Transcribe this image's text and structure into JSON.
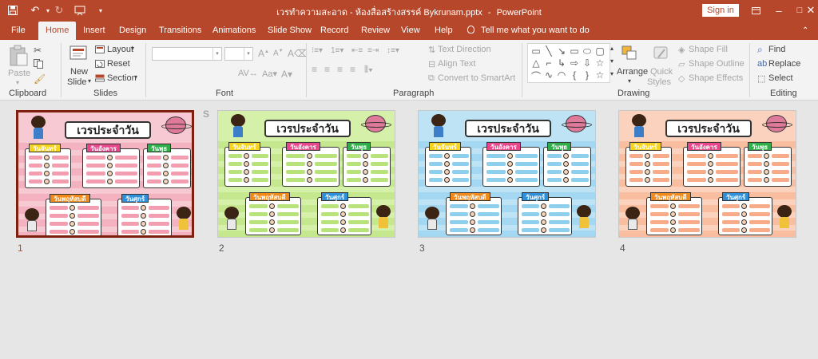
{
  "window": {
    "title": "เวรทำความสะอาด - ห้องสื่อสร้างสรรค์ Bykrunam.pptx",
    "app": "PowerPoint",
    "separator": "-",
    "signin_label": "Sign in"
  },
  "tabs": [
    "File",
    "Home",
    "Insert",
    "Design",
    "Transitions",
    "Animations",
    "Slide Show",
    "Record",
    "Review",
    "View",
    "Help"
  ],
  "active_tab": "Home",
  "tell_me": "Tell me what you want to do",
  "ribbon": {
    "clipboard": {
      "label": "Clipboard",
      "paste": "Paste"
    },
    "slides": {
      "label": "Slides",
      "new_slide": "New",
      "new_slide2": "Slide",
      "layout": "Layout",
      "reset": "Reset",
      "section": "Section"
    },
    "font": {
      "label": "Font",
      "bold": "B",
      "italic": "I",
      "underline": "U",
      "shadow": "S",
      "strike": "abc"
    },
    "paragraph": {
      "label": "Paragraph",
      "text_direction": "Text Direction",
      "align_text": "Align Text",
      "smartart": "Convert to SmartArt"
    },
    "drawing": {
      "label": "Drawing",
      "arrange": "Arrange",
      "quick_styles": "Quick",
      "quick_styles2": "Styles",
      "shape_fill": "Shape Fill",
      "shape_outline": "Shape Outline",
      "shape_effects": "Shape Effects"
    },
    "editing": {
      "label": "Editing",
      "find": "Find",
      "replace": "Replace",
      "select": "Select"
    }
  },
  "slides": [
    {
      "number": "1",
      "title": "เวรประจำวัน",
      "theme": "pink",
      "bg": "#f7c9d2",
      "band": "#f29db0",
      "selected": true
    },
    {
      "number": "2",
      "title": "เวรประจำวัน",
      "theme": "green",
      "bg": "#d5f0a8",
      "band": "#b8e27a",
      "selected": false
    },
    {
      "number": "3",
      "title": "เวรประจำวัน",
      "theme": "blue",
      "bg": "#bde3f5",
      "band": "#8fcfee",
      "selected": false
    },
    {
      "number": "4",
      "title": "เวรประจำวัน",
      "theme": "peach",
      "bg": "#fbd2bd",
      "band": "#f7ab88",
      "selected": false
    }
  ],
  "day_cards": [
    {
      "label": "วันจันทร์",
      "color": "#f5d31e"
    },
    {
      "label": "วันอังคาร",
      "color": "#e8478b"
    },
    {
      "label": "วันพุธ",
      "color": "#2fae4a"
    },
    {
      "label": "วันพฤหัสบดี",
      "color": "#f08a1c"
    },
    {
      "label": "วันศุกร์",
      "color": "#2f8fd8"
    }
  ],
  "colors": {
    "accent": "#b7472a",
    "ribbon_bg": "#f3f3f3",
    "workspace": "#e6e6e6",
    "selected_border": "#7e1f0f"
  }
}
